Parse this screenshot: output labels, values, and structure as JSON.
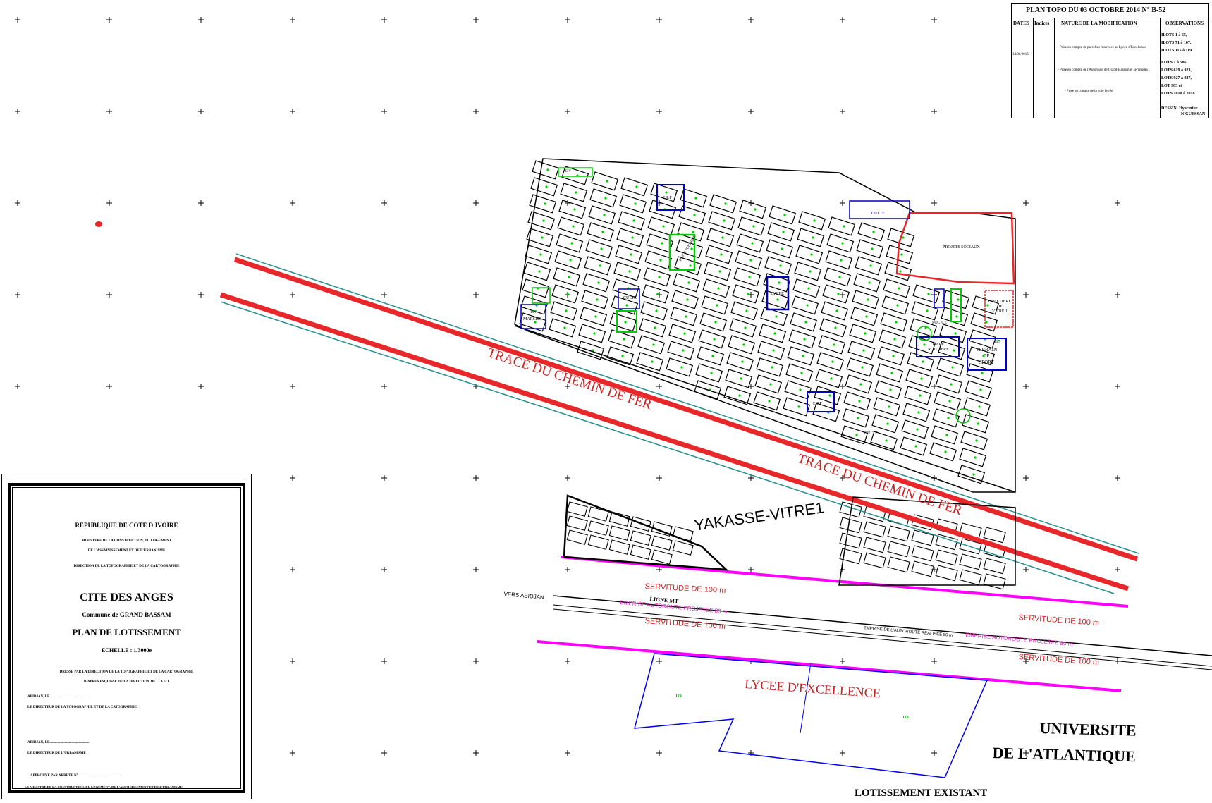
{
  "topo_table": {
    "title": "PLAN TOPO    DU  03  OCTOBRE  2014   N° B-52",
    "headers": {
      "dates": "DATES",
      "indices": "Indices",
      "nature": "NATURE  DE  LA  MODIFICATION",
      "observations": "OBSERVATIONS"
    },
    "date": "14/06/2016",
    "modifications": [
      "- Prise en compte de parcelles réservées au Lycée d'Excellence",
      "- Prise en compte de l'Autoroute de Grand-Bassam et servitudes",
      "- Prise en compte de la voie ferrée"
    ],
    "observations": [
      "ILOTS  1  à  65,",
      "ILOTS  71  à  107,",
      "ILOTS  115  à  119.",
      "LOTS  1  à  586,",
      "LOTS  619  à  923,",
      "LOTS  927  à  937,",
      "LOT  983  et",
      "LOTS  1010  à  1018"
    ],
    "dessin_label": "DESSIN:",
    "dessin_name1": "Hyacinthe",
    "dessin_name2": "N'GUESSAN"
  },
  "map_labels": {
    "railway_1": "TRACE DU CHEMIN DE FER",
    "railway_2": "TRACE DU CHEMIN DE FER",
    "neighborhood": "YAKASSE-VITRE1",
    "servitude_1": "SERVITUDE DE 100 m",
    "servitude_2": "SERVITUDE DE 100 m",
    "servitude_3": "SERVITUDE DE 100 m",
    "servitude_4": "SERVITUDE DE 100 m",
    "emprise_projetee_1": "EMPRISE AUTOROUTE PROJETEE  80 m",
    "emprise_projetee_2": "EMPRISE AUTOROUTE PROJETEE  80 m",
    "emprise_realisee": "EMPRISE  DE  L'AUTOROUTE  REALISEE  80 m",
    "vers_abidjan": "VERS ABIDJAN",
    "ligne_mt": "LIGNE  MT",
    "lycee_excellence": "LYCEE   D'EXCELLENCE",
    "universite_1": "UNIVERSITE",
    "universite_2": "DE L'ATLANTIQUE",
    "lotissement": "LOTISSEMENT  EXISTANT",
    "projets_sociaux": "PROJETS SOCIAUX",
    "cimetiere_1": "CIMETIERE",
    "cimetiere_2": "DE",
    "cimetiere_3": "VITRE 1",
    "terrain_1": "TERRAIN",
    "terrain_2": "DE",
    "terrain_3": "SPORT",
    "terrain_num": "117",
    "gare_1": "GARE",
    "gare_2": "ROUTIERE",
    "lycee": "LYCEE",
    "marche": "MARCHE",
    "marche_num": "107",
    "culte_1": "CULTE",
    "culte_2": "CULTE",
    "culte_3": "CULTE",
    "police": "POLICE",
    "epp_1": "E.P.P",
    "epp_2": "E.P.P",
    "place_publique": "PLACE PUBLIQUE",
    "ev": "E.V",
    "lot_119": "119",
    "lot_118": "118"
  },
  "cartouche": {
    "republique": "REPUBLIQUE  DE  COTE  D'IVOIRE",
    "ministere_1": "MINISTERE DE LA CONSTRUCTION, DU LOGEMENT",
    "ministere_2": "DE L'ASSAINISSEMENT ET DE L'URBANISME",
    "direction": "DIRECTION DE LA TOPOGRAPHIE ET DE LA CARTOGRAPHIE",
    "cite": "CITE DES ANGES",
    "commune": "Commune de GRAND BASSAM",
    "plan": "PLAN DE LOTISSEMENT",
    "echelle": "ECHELLE : 1/3000e",
    "dresse_1": "DRESSE PAR LA DIRECTION DE LA TOPOGRAPHIE ET DE LA CARTOGRAPHIE",
    "dresse_2": "D'APRES ESQUISSE DE LA DIRECTION DE L' A U T",
    "abidjan_1": "ABIDJAN, LE.............................................",
    "directeur_topo": "LE DIRECTEUR DE LA TOPOGRAPHIE ET DE LA CATOGRAPHIE",
    "abidjan_2": "ABIDJAN, LE.............................................",
    "directeur_urba": "LE DIRECTEUR DE L'URBANISME",
    "approuve": "APPROUVE PAR ARRETE N°..................................................",
    "ministre": "LE MINISTRE DE LA CONSTRUCTION, DU LOGEMENT, DE L'ASSAINISSEMENT ET DE L'URBANISME"
  },
  "colors": {
    "railway": "#e8272a",
    "servitude_line": "#ff00ff",
    "emprise_text": "#e020c0",
    "label_red": "#cc1f1f",
    "public_blue": "#0000cc",
    "green_space": "#00cc00",
    "teal": "#2a8f8f"
  }
}
